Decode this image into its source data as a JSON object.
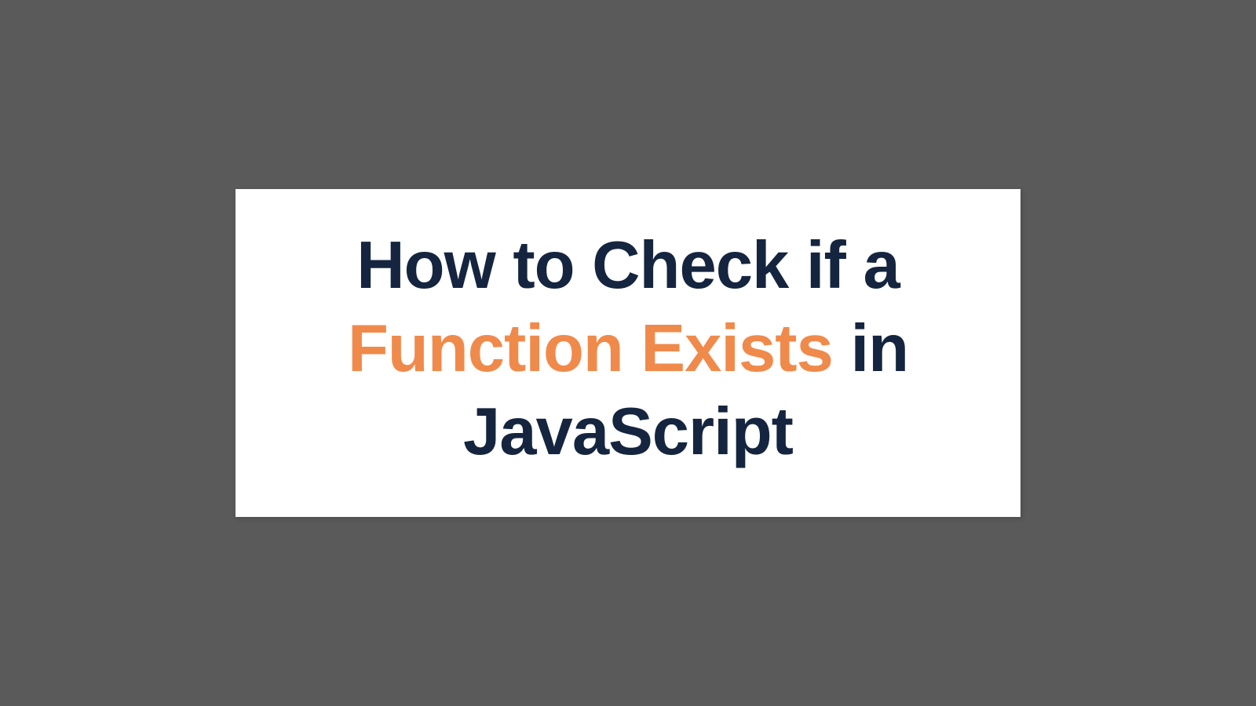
{
  "title": {
    "line1": "How to Check if a",
    "highlight": "Function Exists",
    "line2_suffix": " in",
    "line3": "JavaScript"
  },
  "colors": {
    "background": "#5a5a5a",
    "card": "#ffffff",
    "text_primary": "#15253f",
    "text_highlight": "#f08a4b"
  }
}
